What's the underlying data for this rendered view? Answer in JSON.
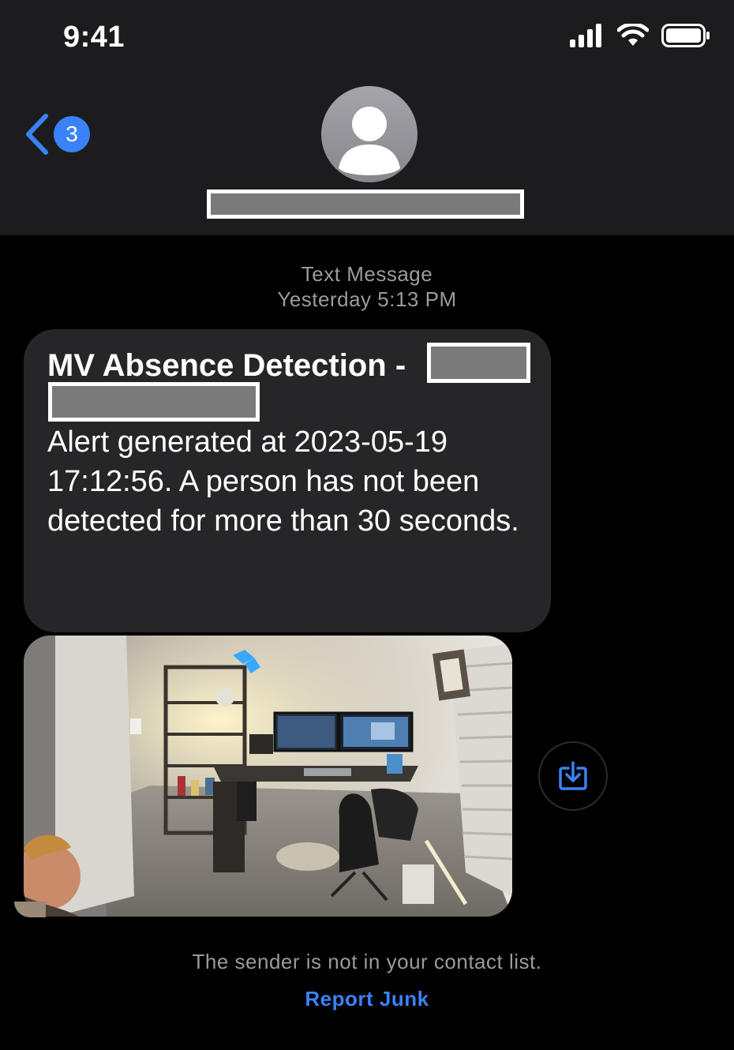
{
  "status_bar": {
    "time": "9:41"
  },
  "nav": {
    "unread_count": "3"
  },
  "thread": {
    "message_type": "Text Message",
    "timestamp": "Yesterday 5:13 PM"
  },
  "message": {
    "title": "MV Absence Detection -",
    "body": "Alert generated at 2023-05-19 17:12:56. A person has not been detected for more than 30 seconds."
  },
  "footer": {
    "notice": "The sender is not in your contact list.",
    "report_junk": "Report Junk"
  },
  "colors": {
    "accent": "#3a82f7",
    "bubble": "#262628",
    "header": "#1c1c1e"
  },
  "icons": [
    "signal-icon",
    "wifi-icon",
    "battery-icon",
    "chevron-left-icon",
    "person-icon",
    "save-to-device-icon"
  ]
}
